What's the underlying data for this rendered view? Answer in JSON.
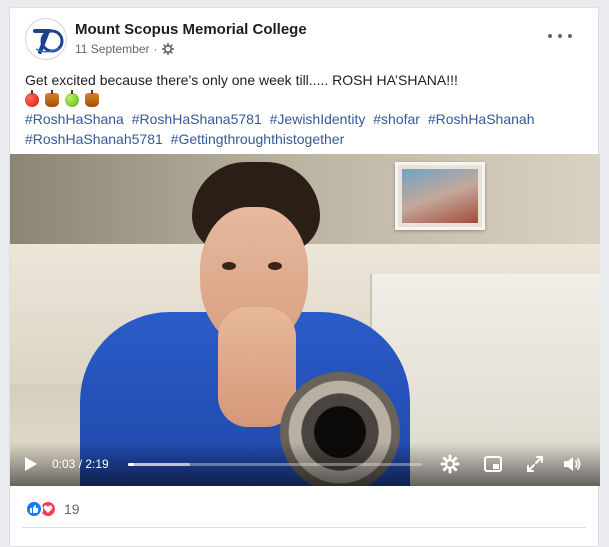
{
  "post": {
    "page_name": "Mount Scopus Memorial College",
    "date": "11 September",
    "separator": "·",
    "privacy_icon": "gear-icon",
    "text": "Get excited because there’s only one week till..... ROSH HA’SHANA!!!",
    "emojis": [
      "red-apple-icon",
      "honey-pot-icon",
      "green-apple-icon",
      "honey-pot-icon"
    ],
    "hashtags_line1": [
      "#RoshHaShana",
      "#RoshHaShana5781",
      "#JewishIdentity",
      "#shofar",
      "#RoshHaShanah"
    ],
    "hashtags_line2": [
      "#RoshHaShanah5781",
      "#Gettingthroughthistogether"
    ]
  },
  "video": {
    "current_time": "0:03",
    "duration": "2:19",
    "time_display": "0:03 / 2:19",
    "progress_fraction": 0.022,
    "buffered_fraction": 0.21,
    "controls": [
      "play-icon",
      "settings-gear-icon",
      "picture-in-picture-icon",
      "fullscreen-icon",
      "volume-icon"
    ]
  },
  "reactions": {
    "types": [
      "like-icon",
      "love-icon"
    ],
    "count": "19"
  },
  "colors": {
    "link": "#385898",
    "like": "#1877f2",
    "love": "#f33e58",
    "meta_text": "#606770"
  }
}
